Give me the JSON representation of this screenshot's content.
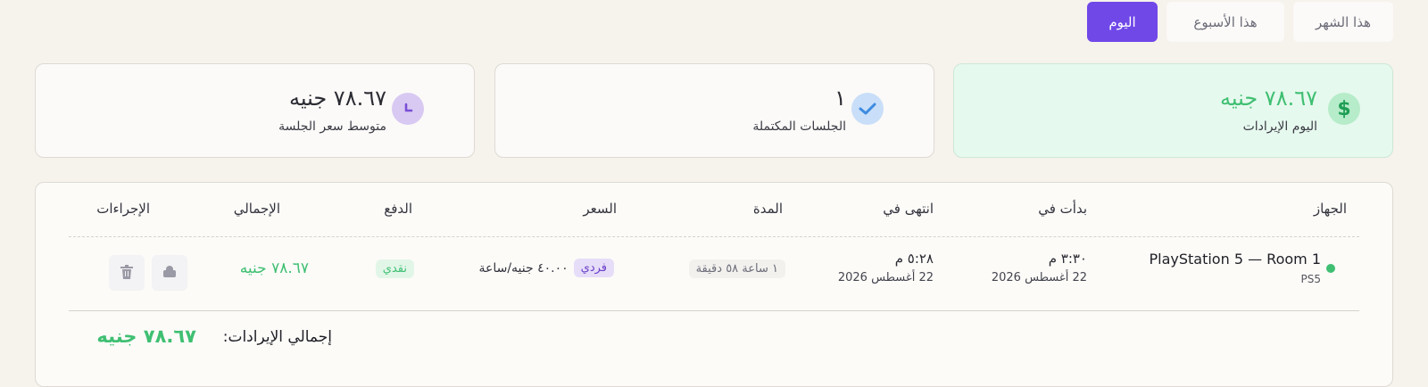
{
  "filters": {
    "today": "اليوم",
    "week": "هذا الأسبوع",
    "month": "هذا الشهر"
  },
  "stats": {
    "revenue": {
      "value": "٧٨.٦٧ جنيه",
      "label": "اليوم الإيرادات",
      "icon": "dollar-icon"
    },
    "sessions": {
      "value": "١",
      "label": "الجلسات المكتملة",
      "icon": "check-icon"
    },
    "average": {
      "value": "٧٨.٦٧ جنيه",
      "label": "متوسط سعر الجلسة",
      "icon": "clock-icon"
    }
  },
  "table": {
    "headers": {
      "device": "الجهاز",
      "started": "بدأت في",
      "ended": "انتهى في",
      "duration": "المدة",
      "price": "السعر",
      "payment": "الدفع",
      "total": "الإجمالي",
      "actions": "الإجراءات"
    },
    "rows": [
      {
        "device_name": "PlayStation 5 — Room 1",
        "device_type": "PS5",
        "started_time": "٣:٣٠ م",
        "started_date": "22 أغسطس 2026",
        "ended_time": "٥:٢٨ م",
        "ended_date": "22 أغسطس 2026",
        "duration": "١ ساعة ٥٨ دقيقة",
        "mode": "فردي",
        "rate": "٤٠.٠٠ جنيه/ساعة",
        "payment": "نقدي",
        "total": "٧٨.٦٧ جنيه"
      }
    ],
    "footer": {
      "label": "إجمالي الإيرادات:",
      "value": "٧٨.٦٧ جنيه"
    }
  },
  "colors": {
    "accent": "#7048e8",
    "green": "#3fbf72",
    "blue": "#3d8be0",
    "purple": "#7a4fd6"
  }
}
